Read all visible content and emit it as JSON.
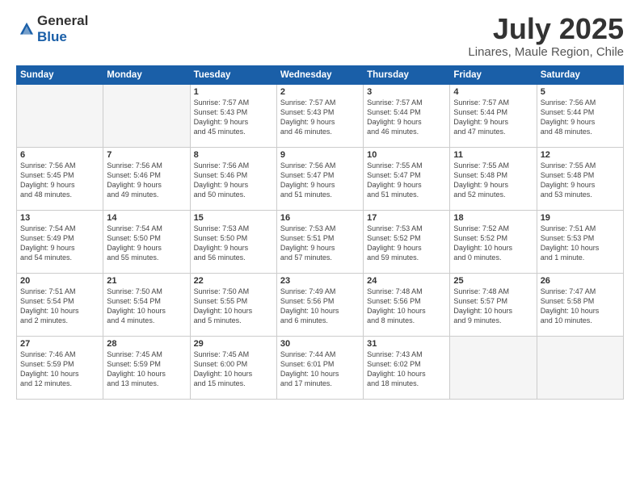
{
  "header": {
    "logo_general": "General",
    "logo_blue": "Blue",
    "month": "July 2025",
    "location": "Linares, Maule Region, Chile"
  },
  "days_of_week": [
    "Sunday",
    "Monday",
    "Tuesday",
    "Wednesday",
    "Thursday",
    "Friday",
    "Saturday"
  ],
  "weeks": [
    [
      {
        "day": "",
        "empty": true
      },
      {
        "day": "",
        "empty": true
      },
      {
        "day": "1",
        "info": "Sunrise: 7:57 AM\nSunset: 5:43 PM\nDaylight: 9 hours\nand 45 minutes."
      },
      {
        "day": "2",
        "info": "Sunrise: 7:57 AM\nSunset: 5:43 PM\nDaylight: 9 hours\nand 46 minutes."
      },
      {
        "day": "3",
        "info": "Sunrise: 7:57 AM\nSunset: 5:44 PM\nDaylight: 9 hours\nand 46 minutes."
      },
      {
        "day": "4",
        "info": "Sunrise: 7:57 AM\nSunset: 5:44 PM\nDaylight: 9 hours\nand 47 minutes."
      },
      {
        "day": "5",
        "info": "Sunrise: 7:56 AM\nSunset: 5:44 PM\nDaylight: 9 hours\nand 48 minutes."
      }
    ],
    [
      {
        "day": "6",
        "info": "Sunrise: 7:56 AM\nSunset: 5:45 PM\nDaylight: 9 hours\nand 48 minutes."
      },
      {
        "day": "7",
        "info": "Sunrise: 7:56 AM\nSunset: 5:46 PM\nDaylight: 9 hours\nand 49 minutes."
      },
      {
        "day": "8",
        "info": "Sunrise: 7:56 AM\nSunset: 5:46 PM\nDaylight: 9 hours\nand 50 minutes."
      },
      {
        "day": "9",
        "info": "Sunrise: 7:56 AM\nSunset: 5:47 PM\nDaylight: 9 hours\nand 51 minutes."
      },
      {
        "day": "10",
        "info": "Sunrise: 7:55 AM\nSunset: 5:47 PM\nDaylight: 9 hours\nand 51 minutes."
      },
      {
        "day": "11",
        "info": "Sunrise: 7:55 AM\nSunset: 5:48 PM\nDaylight: 9 hours\nand 52 minutes."
      },
      {
        "day": "12",
        "info": "Sunrise: 7:55 AM\nSunset: 5:48 PM\nDaylight: 9 hours\nand 53 minutes."
      }
    ],
    [
      {
        "day": "13",
        "info": "Sunrise: 7:54 AM\nSunset: 5:49 PM\nDaylight: 9 hours\nand 54 minutes."
      },
      {
        "day": "14",
        "info": "Sunrise: 7:54 AM\nSunset: 5:50 PM\nDaylight: 9 hours\nand 55 minutes."
      },
      {
        "day": "15",
        "info": "Sunrise: 7:53 AM\nSunset: 5:50 PM\nDaylight: 9 hours\nand 56 minutes."
      },
      {
        "day": "16",
        "info": "Sunrise: 7:53 AM\nSunset: 5:51 PM\nDaylight: 9 hours\nand 57 minutes."
      },
      {
        "day": "17",
        "info": "Sunrise: 7:53 AM\nSunset: 5:52 PM\nDaylight: 9 hours\nand 59 minutes."
      },
      {
        "day": "18",
        "info": "Sunrise: 7:52 AM\nSunset: 5:52 PM\nDaylight: 10 hours\nand 0 minutes."
      },
      {
        "day": "19",
        "info": "Sunrise: 7:51 AM\nSunset: 5:53 PM\nDaylight: 10 hours\nand 1 minute."
      }
    ],
    [
      {
        "day": "20",
        "info": "Sunrise: 7:51 AM\nSunset: 5:54 PM\nDaylight: 10 hours\nand 2 minutes."
      },
      {
        "day": "21",
        "info": "Sunrise: 7:50 AM\nSunset: 5:54 PM\nDaylight: 10 hours\nand 4 minutes."
      },
      {
        "day": "22",
        "info": "Sunrise: 7:50 AM\nSunset: 5:55 PM\nDaylight: 10 hours\nand 5 minutes."
      },
      {
        "day": "23",
        "info": "Sunrise: 7:49 AM\nSunset: 5:56 PM\nDaylight: 10 hours\nand 6 minutes."
      },
      {
        "day": "24",
        "info": "Sunrise: 7:48 AM\nSunset: 5:56 PM\nDaylight: 10 hours\nand 8 minutes."
      },
      {
        "day": "25",
        "info": "Sunrise: 7:48 AM\nSunset: 5:57 PM\nDaylight: 10 hours\nand 9 minutes."
      },
      {
        "day": "26",
        "info": "Sunrise: 7:47 AM\nSunset: 5:58 PM\nDaylight: 10 hours\nand 10 minutes."
      }
    ],
    [
      {
        "day": "27",
        "info": "Sunrise: 7:46 AM\nSunset: 5:59 PM\nDaylight: 10 hours\nand 12 minutes."
      },
      {
        "day": "28",
        "info": "Sunrise: 7:45 AM\nSunset: 5:59 PM\nDaylight: 10 hours\nand 13 minutes."
      },
      {
        "day": "29",
        "info": "Sunrise: 7:45 AM\nSunset: 6:00 PM\nDaylight: 10 hours\nand 15 minutes."
      },
      {
        "day": "30",
        "info": "Sunrise: 7:44 AM\nSunset: 6:01 PM\nDaylight: 10 hours\nand 17 minutes."
      },
      {
        "day": "31",
        "info": "Sunrise: 7:43 AM\nSunset: 6:02 PM\nDaylight: 10 hours\nand 18 minutes."
      },
      {
        "day": "",
        "empty": true
      },
      {
        "day": "",
        "empty": true
      }
    ]
  ]
}
